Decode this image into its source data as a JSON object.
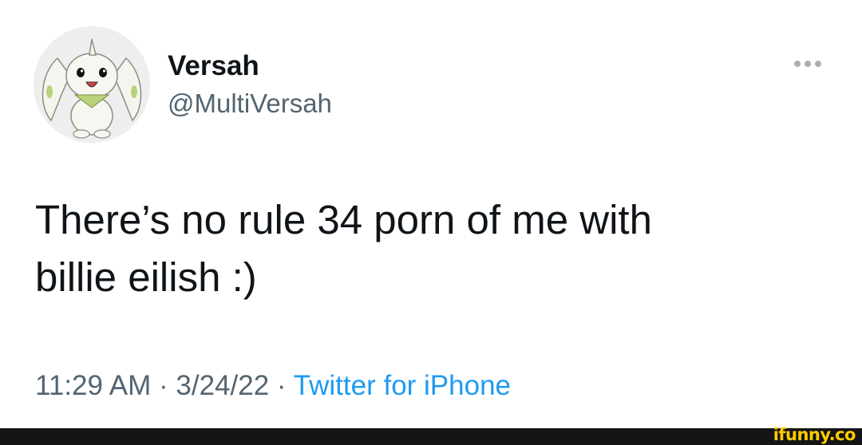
{
  "author": {
    "display_name": "Versah",
    "handle": "@MultiVersah",
    "avatar_icon": "terriermon-avatar"
  },
  "tweet": {
    "text": "There’s no rule 34 porn of me with\nbillie eilish :)",
    "time": "11:29 AM",
    "separator": "·",
    "date": "3/24/22",
    "source": "Twitter for iPhone"
  },
  "more_icon": "more-horizontal-icon",
  "watermark": {
    "logo_text": "ifunny.co"
  },
  "colors": {
    "background": "#ffffff",
    "text_primary": "#0f1419",
    "text_secondary": "#536471",
    "link": "#1d9bf0",
    "footer_bar": "#141414",
    "watermark": "#ffcc00"
  }
}
